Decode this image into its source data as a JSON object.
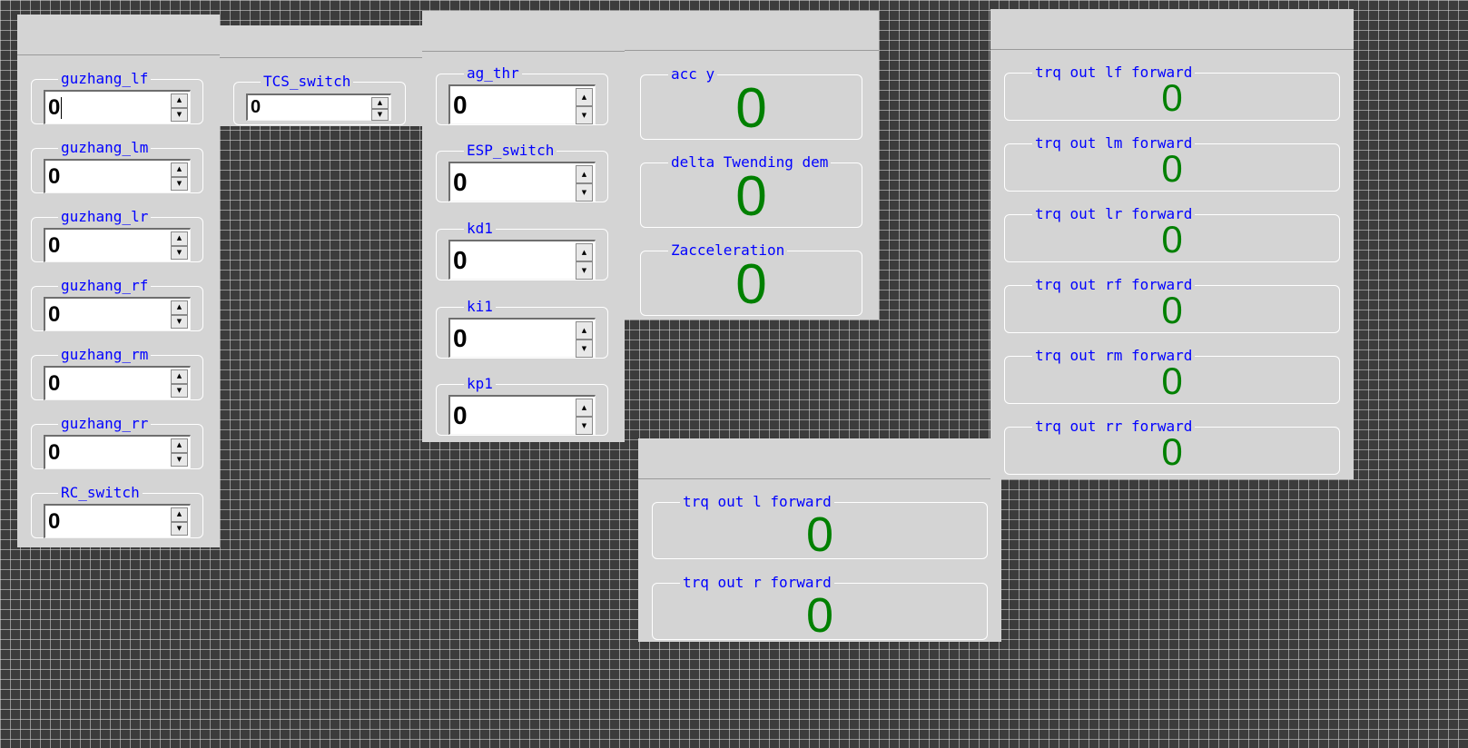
{
  "inputs_left": [
    {
      "label": "guzhang_lf",
      "value": "0"
    },
    {
      "label": "guzhang_lm",
      "value": "0"
    },
    {
      "label": "guzhang_lr",
      "value": "0"
    },
    {
      "label": "guzhang_rf",
      "value": "0"
    },
    {
      "label": "guzhang_rm",
      "value": "0"
    },
    {
      "label": "guzhang_rr",
      "value": "0"
    },
    {
      "label": "RC_switch",
      "value": "0"
    }
  ],
  "tcs": {
    "label": "TCS_switch",
    "value": "0"
  },
  "inputs_mid": [
    {
      "label": "ag_thr",
      "value": "0"
    },
    {
      "label": "ESP_switch",
      "value": "0"
    },
    {
      "label": "kd1",
      "value": "0"
    },
    {
      "label": "ki1",
      "value": "0"
    },
    {
      "label": "kp1",
      "value": "0"
    }
  ],
  "displays_accel": [
    {
      "label": "acc y",
      "value": "0"
    },
    {
      "label": "delta Twending dem",
      "value": "0"
    },
    {
      "label": "Zacceleration",
      "value": "0"
    }
  ],
  "displays_lr": [
    {
      "label": "trq out l forward",
      "value": "0"
    },
    {
      "label": "trq out r forward",
      "value": "0"
    }
  ],
  "displays_wheels": [
    {
      "label": "trq out lf forward",
      "value": "0"
    },
    {
      "label": "trq out lm forward",
      "value": "0"
    },
    {
      "label": "trq out lr forward",
      "value": "0"
    },
    {
      "label": "trq out rf forward",
      "value": "0"
    },
    {
      "label": "trq out rm forward",
      "value": "0"
    },
    {
      "label": "trq out rr forward",
      "value": "0"
    }
  ],
  "icons": {
    "spin_up": "▲",
    "spin_down": "▼"
  },
  "colors": {
    "label": "#0000ff",
    "display_value": "#008000",
    "panel": "#d4d4d4",
    "background": "#3c3c3c"
  }
}
